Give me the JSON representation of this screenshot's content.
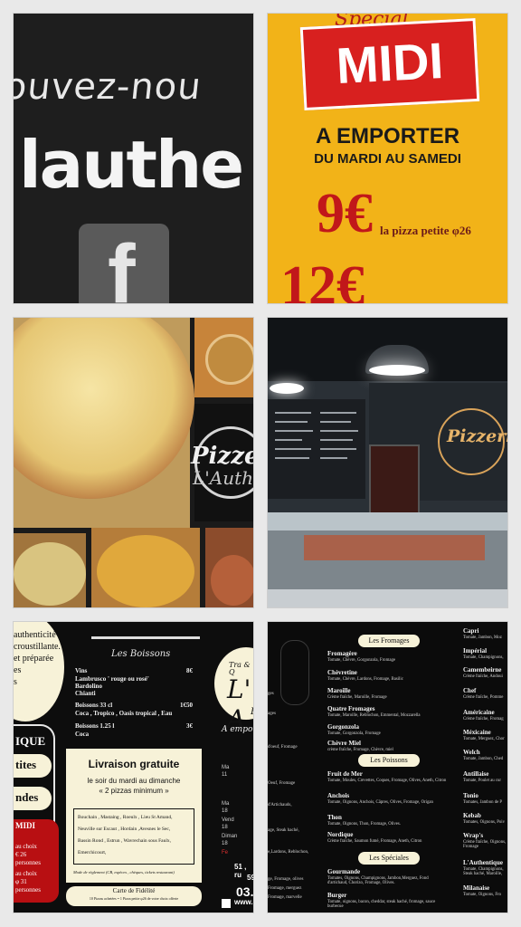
{
  "tile1": {
    "line1": "ouvez-nou",
    "line2": "lauthe",
    "fb": "f"
  },
  "tile2": {
    "special": "Special",
    "midi": "MIDI",
    "emporter": "A EMPORTER",
    "days": "DU MARDI AU SAMEDI",
    "price1": "9€",
    "price1_label": "la pizza petite φ26",
    "price2": "12€"
  },
  "tile3": {
    "logo_1": "Pizze",
    "logo_2": "L'Authe"
  },
  "tile4": {
    "sign": "Pizzeria"
  },
  "tile5": {
    "bubble": [
      "authenticité",
      "",
      "croustillante.",
      "",
      "et préparée",
      "es",
      "s"
    ],
    "que": "IQUE",
    "pills": [
      "tites",
      "ndes"
    ],
    "red": [
      "MIDI",
      "au choix",
      "€ 26",
      "personnes",
      "au choix",
      "φ 31",
      "personnes"
    ],
    "boissons_title": "Les Boissons",
    "drinks": [
      {
        "name": "Vins",
        "price": "8€"
      },
      {
        "name": "Lambrusco ' rouge ou rosé'",
        "price": ""
      },
      {
        "name": "Bardolino",
        "price": ""
      },
      {
        "name": "Chianti",
        "price": ""
      },
      {
        "name": "Boissons 33 cl",
        "price": "1€50"
      },
      {
        "name": "Coca , Tropico , Oasis tropical , Eau",
        "price": ""
      },
      {
        "name": "Boissons 1.25 l",
        "price": "3€"
      },
      {
        "name": "Coca",
        "price": ""
      }
    ],
    "livraison": "Livraison gratuite",
    "livraison_sub1": "le soir du mardi au dimanche",
    "livraison_sub2": "« 2 pizzas minimum »",
    "towns": [
      "Bouchain , Mastaing , Roeulx , Lieu St Amand,",
      "Neuville sur Escaut , Hordain ,Avesnes le Sec,",
      "Bassin Rond , Estrun , Wavrechain sous Faulx,",
      "Emerchicourt,"
    ],
    "modes": "Mode de règlement (CB, espèces , chèques, tickets restaurant)",
    "fidelite": "Carte de Fidélité",
    "fidelite_sub": "10 Pizzas achetées = 1 Pizza petite φ26 de votre choix offerte",
    "logo_top": "Tra & Q",
    "logo_A": "L' A",
    "logo_B": "B",
    "emporter": "A empo",
    "side": [
      "Ma",
      "11",
      "Ma",
      "18",
      "Vend",
      "18",
      "Diman",
      "18",
      "Fe"
    ],
    "addr": "51 , ru",
    "num": "5911",
    "phone": "03.27",
    "web": "www.piz"
  },
  "tile6": {
    "sec_fromages": "Les Fromages",
    "sec_poissons": "Les Poissons",
    "sec_speciales": "Les Spéciales",
    "left_labels": [
      "ges",
      "ages",
      "d'oeuf, Fromage",
      "Oeuf, Fromage",
      "d'Artichauds,",
      "age, Steak haché,",
      "e,Lardons, Reblochon,",
      "ge, Fromage, olives",
      "Fromage, merguez",
      "Fromage, marvelle"
    ],
    "pizzas_mid": [
      {
        "name": "Fromagère",
        "desc": "Tomate, Chèvre, Gorgonzola, Fromage"
      },
      {
        "name": "Chèvretine",
        "desc": "Tomate, Chèvre, Lardons, Fromage, Basilic"
      },
      {
        "name": "Maroille",
        "desc": "Crème fraîche, Maroille, Fromage"
      },
      {
        "name": "Quatre Fromages",
        "desc": "Tomate, Maroille, Reblochon, Emmental, Mozzarella"
      },
      {
        "name": "Gorgonzola",
        "desc": "Tomate, Gorgonzola, Fromage"
      },
      {
        "name": "Chèvre Miel",
        "desc": "crème fraîche, Fromage, Chèvre, miel"
      },
      {
        "name": "Fruit de Mer",
        "desc": "Tomate, Moules, Crevettes, Coques, Fromage, Olives, Aneth, Citron"
      },
      {
        "name": "Anchois",
        "desc": "Tomate, Oignons, Anchois, Câpres, Olives, Fromage, Origan"
      },
      {
        "name": "Thon",
        "desc": "Tomate, Oignons, Thon, Fromage, Olives."
      },
      {
        "name": "Nordique",
        "desc": "Crème fraîche, Saumon fumé, Fromage, Aneth, Citron"
      },
      {
        "name": "Gourmande",
        "desc": "Tomates, Oignons, Champignons, Jambon,Merguez, Fond d'artichaud, Chorizo, Fromage, Olives."
      },
      {
        "name": "Burger",
        "desc": "Tomate, oignons, bacon, cheddar, steak haché, fromage, sauce burbecue"
      }
    ],
    "pizzas_right": [
      {
        "name": "Capri",
        "desc": "Tomate, Jambon, Moz"
      },
      {
        "name": "Impérial",
        "desc": "Tomate, Champignons,"
      },
      {
        "name": "Camembeirne",
        "desc": "Crème fraîche, Andoui"
      },
      {
        "name": "Chef",
        "desc": "Crème fraîche, Pomme"
      },
      {
        "name": "Américaine",
        "desc": "Crème fraîche, Fromag"
      },
      {
        "name": "Méxicaine",
        "desc": "Tomate, Merguez, Chor"
      },
      {
        "name": "Welch",
        "desc": "Tomate, Jambon, Ched"
      },
      {
        "name": "Antillaise",
        "desc": "Tomate, Poulet au cur"
      },
      {
        "name": "Tonio",
        "desc": "Tomates, Jambon de P"
      },
      {
        "name": "Kebab",
        "desc": "Tomates, Oignons, Poiv"
      },
      {
        "name": "Wrap's",
        "desc": "Crème fraîche, Oignons, Fromage"
      },
      {
        "name": "L'Authentique",
        "desc": "Tomate, Champignons, Steak haché, Maroille,"
      },
      {
        "name": "Milanaise",
        "desc": "Tomate, Oignons, Fro"
      }
    ]
  }
}
